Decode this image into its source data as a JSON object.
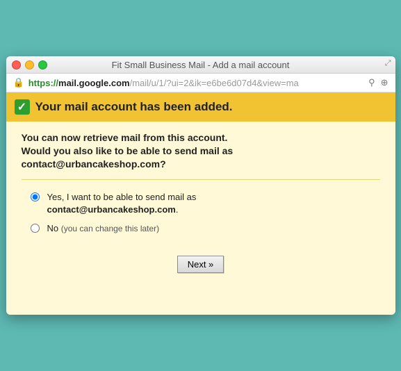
{
  "window": {
    "title": "Fit Small Business Mail - Add a mail account"
  },
  "address": {
    "scheme": "https://",
    "host": "mail.google.com",
    "path": "/mail/u/1/?ui=2&ik=e6be6d07d4&view=ma"
  },
  "banner": {
    "headline": "Your mail account has been added."
  },
  "intro": {
    "line1": "You can now retrieve mail from this account.",
    "line2": "Would you also like to be able to send mail as",
    "email_q": "contact@urbancakeshop.com?"
  },
  "options": {
    "yes_prefix": "Yes, I want to be able to send mail as",
    "yes_email": "contact@urbancakeshop.com",
    "yes_suffix": ".",
    "no_label": "No",
    "no_hint": "(you can change this later)"
  },
  "actions": {
    "next": "Next »"
  }
}
